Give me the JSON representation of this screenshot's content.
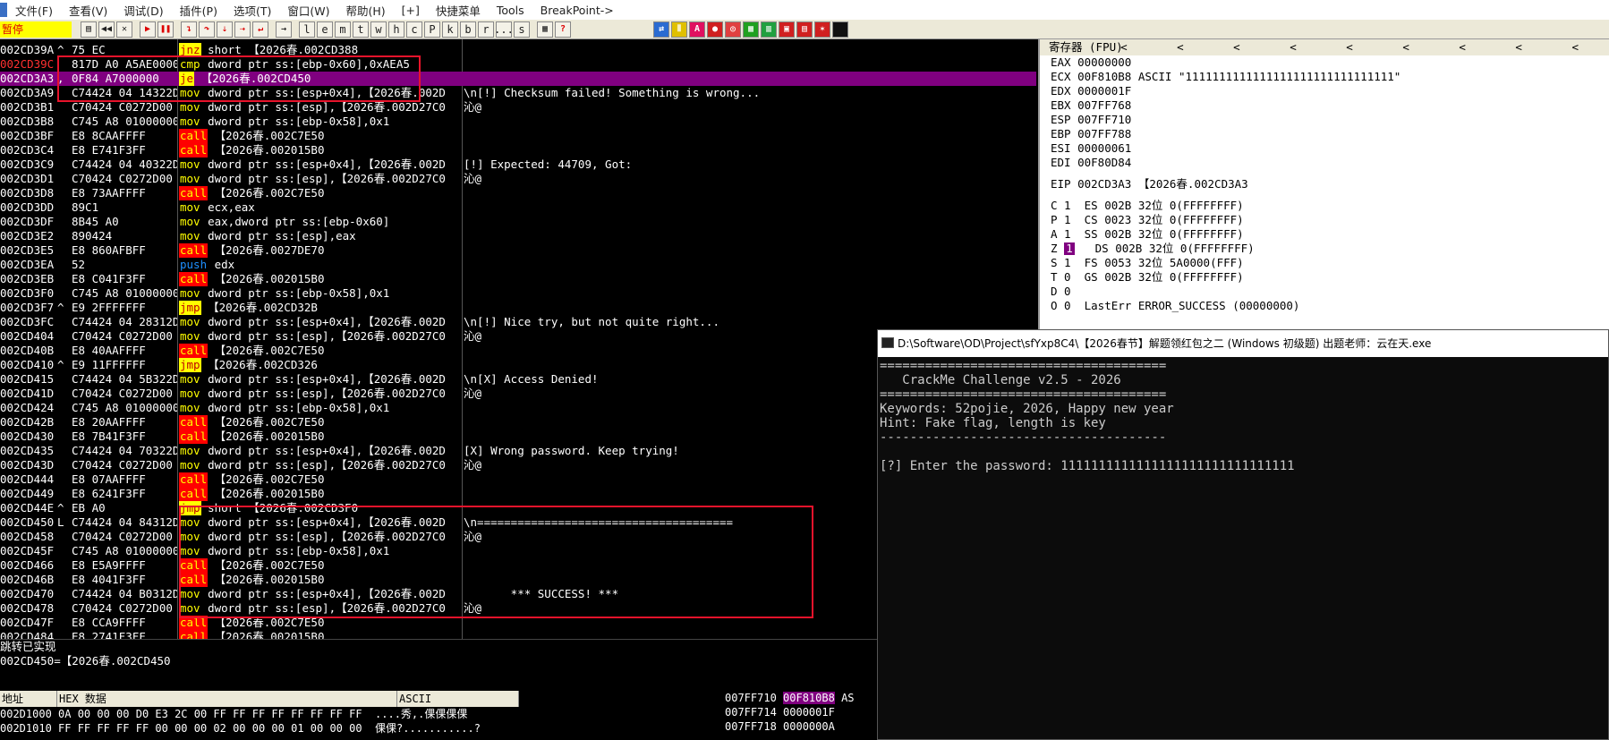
{
  "menu": {
    "items": [
      "文件(F)",
      "查看(V)",
      "调试(D)",
      "插件(P)",
      "选项(T)",
      "窗口(W)",
      "帮助(H)",
      "[+]",
      "快捷菜单",
      "Tools",
      "BreakPoint->"
    ]
  },
  "toolbar": {
    "status": "暂停",
    "letter_buttons": [
      "l",
      "e",
      "m",
      "t",
      "w",
      "h",
      "c",
      "P",
      "k",
      "b",
      "r",
      "...",
      "s"
    ]
  },
  "disasm": {
    "rows": [
      {
        "addr": "002CD39A",
        "mk": "^",
        "hex": "75 EC",
        "op": "jnz",
        "cls": "jcc",
        "args": " short 【2026春.002CD388",
        "cmt": ""
      },
      {
        "addr": "002CD39C",
        "mk": " ",
        "hex": "817D A0 A5AE0000",
        "op": "cmp",
        "cls": "cmp",
        "args": " dword ptr ss:[ebp-0x60],0xAEA5",
        "cmt": "",
        "addrsel": true
      },
      {
        "addr": "002CD3A3",
        "mk": ",",
        "hex": "0F84 A7000000",
        "op": "je",
        "cls": "jcc",
        "args": " 【2026春.002CD450",
        "cmt": "",
        "sel": true
      },
      {
        "addr": "002CD3A9",
        "mk": " ",
        "hex": "C74424 04 14322D00",
        "op": "mov",
        "cls": "mov",
        "args": " dword ptr ss:[esp+0x4],【2026春.002D",
        "cmt": "\\n[!] Checksum failed! Something is wrong..."
      },
      {
        "addr": "002CD3B1",
        "mk": " ",
        "hex": "C70424 C0272D00",
        "op": "mov",
        "cls": "mov",
        "args": " dword ptr ss:[esp],【2026春.002D27C0",
        "cmt": "沁@"
      },
      {
        "addr": "002CD3B8",
        "mk": " ",
        "hex": "C745 A8 01000000",
        "op": "mov",
        "cls": "mov",
        "args": " dword ptr ss:[ebp-0x58],0x1",
        "cmt": ""
      },
      {
        "addr": "002CD3BF",
        "mk": " ",
        "hex": "E8 8CAAFFFF",
        "op": "call",
        "cls": "call",
        "args": " 【2026春.002C7E50",
        "cmt": ""
      },
      {
        "addr": "002CD3C4",
        "mk": " ",
        "hex": "E8 E741F3FF",
        "op": "call",
        "cls": "call",
        "args": " 【2026春.002015B0",
        "cmt": ""
      },
      {
        "addr": "002CD3C9",
        "mk": " ",
        "hex": "C74424 04 40322D00",
        "op": "mov",
        "cls": "mov",
        "args": " dword ptr ss:[esp+0x4],【2026春.002D",
        "cmt": "[!] Expected: 44709, Got:"
      },
      {
        "addr": "002CD3D1",
        "mk": " ",
        "hex": "C70424 C0272D00",
        "op": "mov",
        "cls": "mov",
        "args": " dword ptr ss:[esp],【2026春.002D27C0",
        "cmt": "沁@"
      },
      {
        "addr": "002CD3D8",
        "mk": " ",
        "hex": "E8 73AAFFFF",
        "op": "call",
        "cls": "call",
        "args": " 【2026春.002C7E50",
        "cmt": ""
      },
      {
        "addr": "002CD3DD",
        "mk": " ",
        "hex": "89C1",
        "op": "mov",
        "cls": "mov",
        "args": " ecx,eax",
        "cmt": ""
      },
      {
        "addr": "002CD3DF",
        "mk": " ",
        "hex": "8B45 A0",
        "op": "mov",
        "cls": "mov",
        "args": " eax,dword ptr ss:[ebp-0x60]",
        "cmt": ""
      },
      {
        "addr": "002CD3E2",
        "mk": " ",
        "hex": "890424",
        "op": "mov",
        "cls": "mov",
        "args": " dword ptr ss:[esp],eax",
        "cmt": ""
      },
      {
        "addr": "002CD3E5",
        "mk": " ",
        "hex": "E8 860AFBFF",
        "op": "call",
        "cls": "call",
        "args": " 【2026春.0027DE70",
        "cmt": ""
      },
      {
        "addr": "002CD3EA",
        "mk": " ",
        "hex": "52",
        "op": "push",
        "cls": "push",
        "args": " edx",
        "cmt": ""
      },
      {
        "addr": "002CD3EB",
        "mk": " ",
        "hex": "E8 C041F3FF",
        "op": "call",
        "cls": "call",
        "args": " 【2026春.002015B0",
        "cmt": ""
      },
      {
        "addr": "002CD3F0",
        "mk": " ",
        "hex": "C745 A8 01000000",
        "op": "mov",
        "cls": "mov",
        "args": " dword ptr ss:[ebp-0x58],0x1",
        "cmt": ""
      },
      {
        "addr": "002CD3F7",
        "mk": "^",
        "hex": "E9 2FFFFFFF",
        "op": "jmp",
        "cls": "jmp",
        "args": " 【2026春.002CD32B",
        "cmt": ""
      },
      {
        "addr": "002CD3FC",
        "mk": " ",
        "hex": "C74424 04 28312D00",
        "op": "mov",
        "cls": "mov",
        "args": " dword ptr ss:[esp+0x4],【2026春.002D",
        "cmt": "\\n[!] Nice try, but not quite right..."
      },
      {
        "addr": "002CD404",
        "mk": " ",
        "hex": "C70424 C0272D00",
        "op": "mov",
        "cls": "mov",
        "args": " dword ptr ss:[esp],【2026春.002D27C0",
        "cmt": "沁@"
      },
      {
        "addr": "002CD40B",
        "mk": " ",
        "hex": "E8 40AAFFFF",
        "op": "call",
        "cls": "call",
        "args": " 【2026春.002C7E50",
        "cmt": ""
      },
      {
        "addr": "002CD410",
        "mk": "^",
        "hex": "E9 11FFFFFF",
        "op": "jmp",
        "cls": "jmp",
        "args": " 【2026春.002CD326",
        "cmt": ""
      },
      {
        "addr": "002CD415",
        "mk": " ",
        "hex": "C74424 04 5B322D00",
        "op": "mov",
        "cls": "mov",
        "args": " dword ptr ss:[esp+0x4],【2026春.002D",
        "cmt": "\\n[X] Access Denied!"
      },
      {
        "addr": "002CD41D",
        "mk": " ",
        "hex": "C70424 C0272D00",
        "op": "mov",
        "cls": "mov",
        "args": " dword ptr ss:[esp],【2026春.002D27C0",
        "cmt": "沁@"
      },
      {
        "addr": "002CD424",
        "mk": " ",
        "hex": "C745 A8 01000000",
        "op": "mov",
        "cls": "mov",
        "args": " dword ptr ss:[ebp-0x58],0x1",
        "cmt": ""
      },
      {
        "addr": "002CD42B",
        "mk": " ",
        "hex": "E8 20AAFFFF",
        "op": "call",
        "cls": "call",
        "args": " 【2026春.002C7E50",
        "cmt": ""
      },
      {
        "addr": "002CD430",
        "mk": " ",
        "hex": "E8 7B41F3FF",
        "op": "call",
        "cls": "call",
        "args": " 【2026春.002015B0",
        "cmt": ""
      },
      {
        "addr": "002CD435",
        "mk": " ",
        "hex": "C74424 04 70322D00",
        "op": "mov",
        "cls": "mov",
        "args": " dword ptr ss:[esp+0x4],【2026春.002D",
        "cmt": "[X] Wrong password. Keep trying!"
      },
      {
        "addr": "002CD43D",
        "mk": " ",
        "hex": "C70424 C0272D00",
        "op": "mov",
        "cls": "mov",
        "args": " dword ptr ss:[esp],【2026春.002D27C0",
        "cmt": "沁@"
      },
      {
        "addr": "002CD444",
        "mk": " ",
        "hex": "E8 07AAFFFF",
        "op": "call",
        "cls": "call",
        "args": " 【2026春.002C7E50",
        "cmt": ""
      },
      {
        "addr": "002CD449",
        "mk": " ",
        "hex": "E8 6241F3FF",
        "op": "call",
        "cls": "call",
        "args": " 【2026春.002015B0",
        "cmt": ""
      },
      {
        "addr": "002CD44E",
        "mk": "^",
        "hex": "EB A0",
        "op": "jmp",
        "cls": "jmp",
        "args": " short 【2026春.002CD3F0",
        "cmt": ""
      },
      {
        "addr": "002CD450",
        "mk": "L",
        "hex": "C74424 04 84312D00",
        "op": "mov",
        "cls": "mov",
        "args": " dword ptr ss:[esp+0x4],【2026春.002D",
        "cmt": "\\n======================================"
      },
      {
        "addr": "002CD458",
        "mk": " ",
        "hex": "C70424 C0272D00",
        "op": "mov",
        "cls": "mov",
        "args": " dword ptr ss:[esp],【2026春.002D27C0",
        "cmt": "沁@"
      },
      {
        "addr": "002CD45F",
        "mk": " ",
        "hex": "C745 A8 01000000",
        "op": "mov",
        "cls": "mov",
        "args": " dword ptr ss:[ebp-0x58],0x1",
        "cmt": ""
      },
      {
        "addr": "002CD466",
        "mk": " ",
        "hex": "E8 E5A9FFFF",
        "op": "call",
        "cls": "call",
        "args": " 【2026春.002C7E50",
        "cmt": ""
      },
      {
        "addr": "002CD46B",
        "mk": " ",
        "hex": "E8 4041F3FF",
        "op": "call",
        "cls": "call",
        "args": " 【2026春.002015B0",
        "cmt": ""
      },
      {
        "addr": "002CD470",
        "mk": " ",
        "hex": "C74424 04 B0312D00",
        "op": "mov",
        "cls": "mov",
        "args": " dword ptr ss:[esp+0x4],【2026春.002D",
        "cmt": "       *** SUCCESS! ***"
      },
      {
        "addr": "002CD478",
        "mk": " ",
        "hex": "C70424 C0272D00",
        "op": "mov",
        "cls": "mov",
        "args": " dword ptr ss:[esp],【2026春.002D27C0",
        "cmt": "沁@"
      },
      {
        "addr": "002CD47F",
        "mk": " ",
        "hex": "E8 CCA9FFFF",
        "op": "call",
        "cls": "call",
        "args": " 【2026春.002C7E50",
        "cmt": ""
      },
      {
        "addr": "002CD484",
        "mk": " ",
        "hex": "E8 2741F3FF",
        "op": "call",
        "cls": "call",
        "args": " 【2026春.002015B0",
        "cmt": ""
      }
    ]
  },
  "info": {
    "line1": "跳转已实现",
    "line2": "002CD450=【2026春.002CD450"
  },
  "dump": {
    "headers": [
      "地址",
      "HEX 数据",
      "ASCII"
    ],
    "lines": [
      "002D1000 0A 00 00 00 D0 E3 2C 00 FF FF FF FF FF FF FF FF  ....秀,.倮倮倮倮",
      "002D1010 FF FF FF FF FF 00 00 00 02 00 00 00 01 00 00 00  倮倮?...........?"
    ]
  },
  "stack": {
    "lines": [
      {
        "addr": "007FF710",
        "val": "00F810B8",
        "hl": true,
        "extra": "AS"
      },
      {
        "addr": "007FF714",
        "val": "0000001F"
      },
      {
        "addr": "007FF718",
        "val": "0000000A"
      }
    ]
  },
  "registers": {
    "title": "寄存器 (FPU)",
    "arrows": "< < < < < < < < <",
    "regs": [
      "EAX 00000000",
      "ECX 00F810B8 ASCII \"1111111111111111111111111111111\"",
      "EDX 0000001F",
      "EBX 007FF768",
      "ESP 007FF710",
      "EBP 007FF788",
      "ESI 00000061",
      "EDI 00F80D84"
    ],
    "eip": "EIP 002CD3A3 【2026春.002CD3A3",
    "flags": [
      "C 1  ES 002B 32位 0(FFFFFFFF)",
      "P 1  CS 0023 32位 0(FFFFFFFF)",
      "A 1  SS 002B 32位 0(FFFFFFFF)",
      "   DS 002B 32位 0(FFFFFFFF)",
      "S 1  FS 0053 32位 5A0000(FFF)",
      "T 0  GS 002B 32位 0(FFFFFFFF)",
      "D 0",
      "O 0  LastErr ERROR_SUCCESS (00000000)"
    ],
    "zflag_label": "Z",
    "zflag_value": "1"
  },
  "console": {
    "title": "D:\\Software\\OD\\Project\\sfYxp8C4\\【2026春节】解题领红包之二 (Windows 初级题) 出题老师：云在天.exe",
    "lines": [
      "======================================",
      "   CrackMe Challenge v2.5 - 2026",
      "======================================",
      "Keywords: 52pojie, 2026, Happy new year",
      "Hint: Fake flag, length is key",
      "--------------------------------------",
      "",
      "[?] Enter the password: 1111111111111111111111111111111"
    ]
  }
}
